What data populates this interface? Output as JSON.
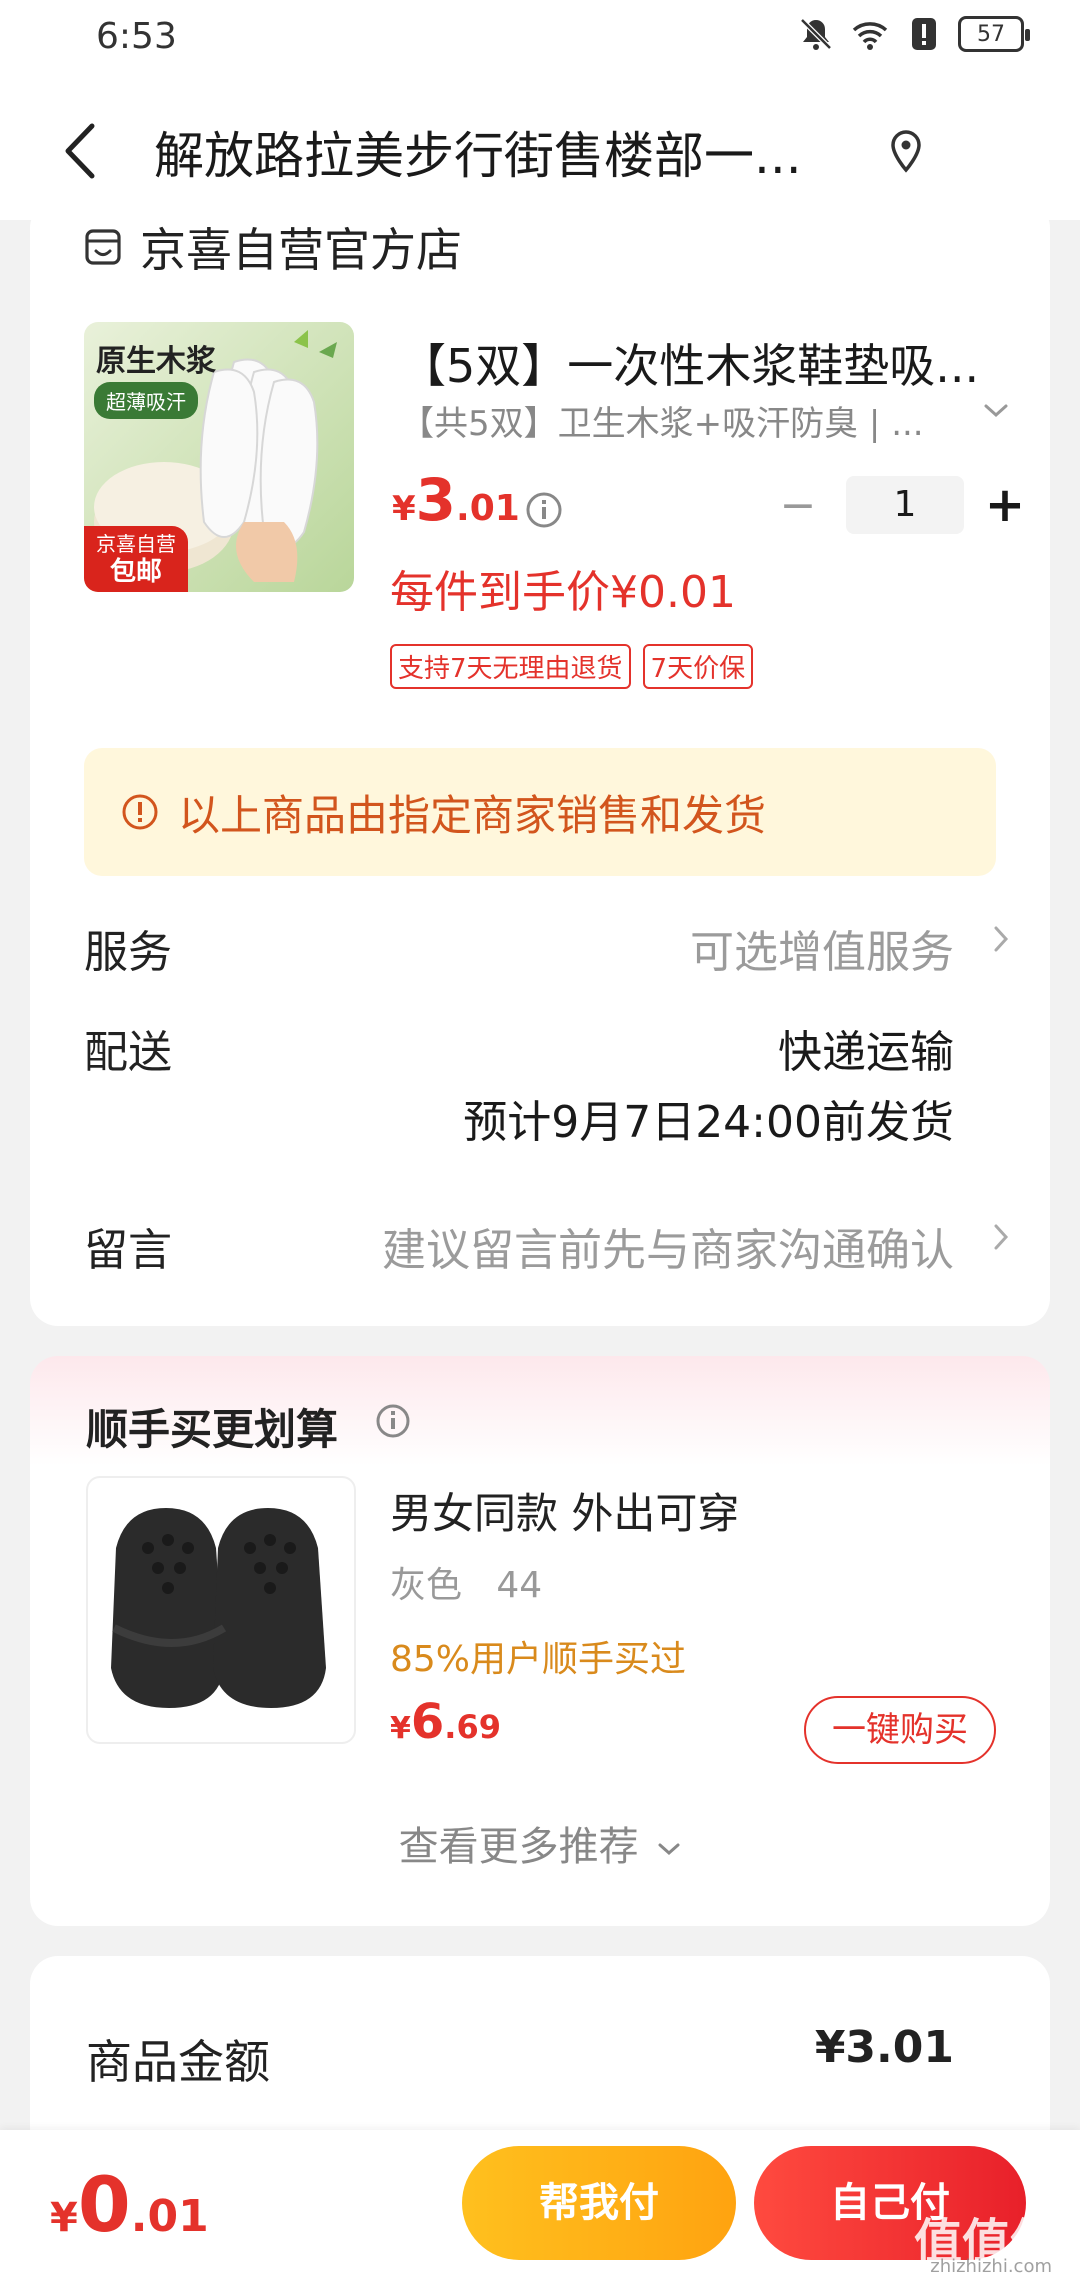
{
  "status_bar": {
    "time": "6:53",
    "battery": "57",
    "icons": [
      "mute-icon",
      "wifi-icon",
      "alert-icon",
      "battery-icon"
    ]
  },
  "nav": {
    "title": "解放路拉美步行街售楼部一...",
    "back_icon": "chevron-left-icon",
    "location_icon": "location-pin-icon"
  },
  "shop": {
    "name": "京喜自营官方店",
    "icon": "store-icon"
  },
  "product": {
    "thumb_label": "原生木浆",
    "thumb_badge_top": "超薄吸汗",
    "thumb_badge_bottom_1": "京喜自营",
    "thumb_badge_bottom_2": "包邮",
    "title": "【5双】一次性木浆鞋垫吸...",
    "spec": "【共5双】卫生木浆+吸汗防臭 | ...",
    "price_symbol": "¥",
    "price_int": "3",
    "price_dec": ".01",
    "quantity": "1",
    "minus": "−",
    "plus": "+",
    "unit_price": "每件到手价¥0.01",
    "tags": [
      "支持7天无理由退货",
      "7天价保"
    ]
  },
  "notice": {
    "text": "以上商品由指定商家销售和发货"
  },
  "service": {
    "label": "服务",
    "value": "可选增值服务"
  },
  "delivery": {
    "label": "配送",
    "method": "快递运输",
    "eta": "预计9月7日24:00前发货"
  },
  "message": {
    "label": "留言",
    "placeholder": "建议留言前先与商家沟通确认"
  },
  "recommend": {
    "title": "顺手买更划算",
    "item_name": "男女同款 外出可穿",
    "item_spec": "灰色   44",
    "item_bought": "85%用户顺手买过",
    "price_symbol": "¥",
    "price_int": "6",
    "price_dec": ".69",
    "buy_label": "一键购买",
    "see_more": "查看更多推荐"
  },
  "amount": {
    "label": "商品金额",
    "value": "¥3.01"
  },
  "bottom": {
    "price_symbol": "¥",
    "price_int": "0",
    "price_dec": ".01",
    "help_pay": "帮我付",
    "self_pay": "自己付",
    "watermark": "值值值",
    "watermark_sub": "zhizhizhi.com"
  },
  "colors": {
    "accent_red": "#e4322b",
    "notice_bg": "#fff7dc",
    "notice_text": "#d2551d",
    "help_pay_yellow": "#ffb418",
    "bought_orange": "#d98a1c"
  }
}
